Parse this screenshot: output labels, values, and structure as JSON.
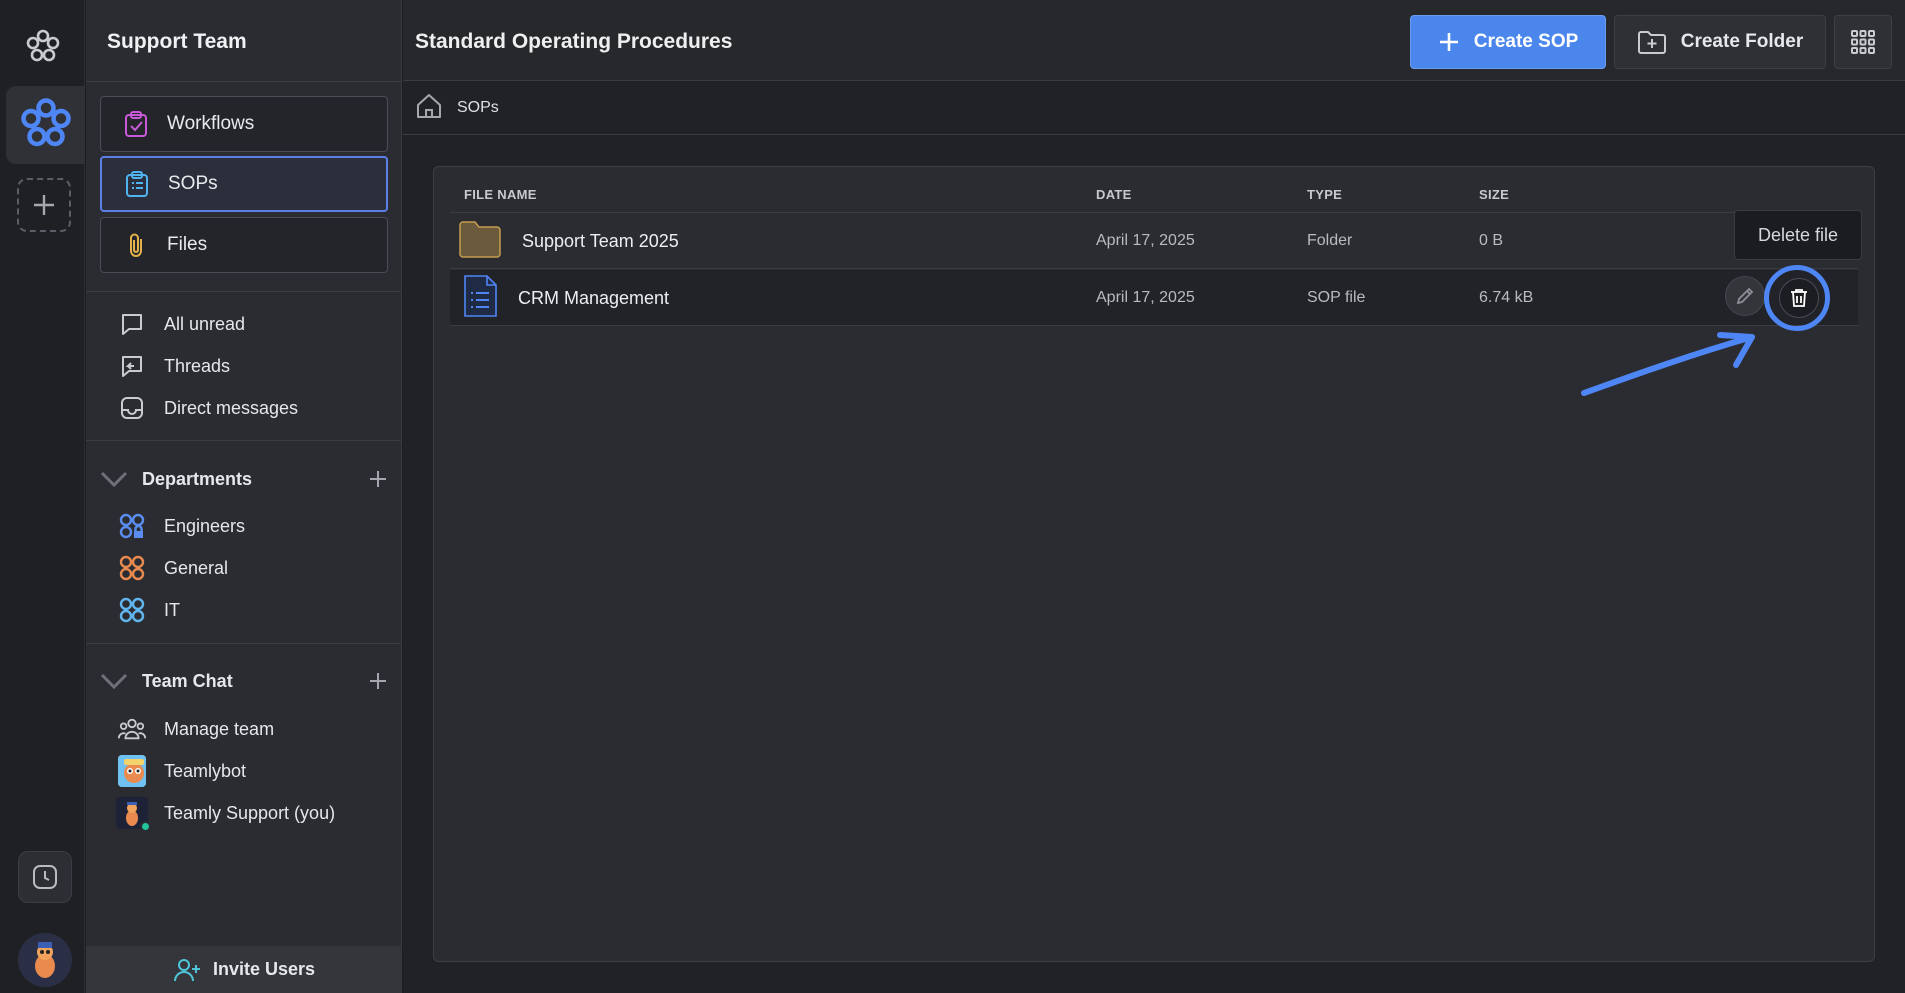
{
  "sidebar": {
    "team_name": "Support Team",
    "nav": [
      {
        "label": "Workflows",
        "icon": "clipboard-check-icon"
      },
      {
        "label": "SOPs",
        "icon": "clipboard-list-icon"
      },
      {
        "label": "Files",
        "icon": "paperclip-icon"
      }
    ],
    "inbox": [
      {
        "label": "All unread",
        "icon": "chat-bubble-icon"
      },
      {
        "label": "Threads",
        "icon": "threads-icon"
      },
      {
        "label": "Direct messages",
        "icon": "inbox-icon"
      }
    ],
    "departments": {
      "title": "Departments",
      "items": [
        {
          "label": "Engineers",
          "icon": "department-locked-icon",
          "color": "#5b8df0"
        },
        {
          "label": "General",
          "icon": "department-icon",
          "color": "#e98a4f"
        },
        {
          "label": "IT",
          "icon": "department-icon",
          "color": "#62b6f0"
        }
      ]
    },
    "team_chat": {
      "title": "Team Chat",
      "items": [
        {
          "label": "Manage team",
          "icon": "team-icon"
        },
        {
          "label": "Teamlybot",
          "icon": "bot-avatar"
        },
        {
          "label": "Teamly Support (you)",
          "icon": "user-avatar"
        }
      ]
    },
    "invite_label": "Invite Users"
  },
  "header": {
    "title": "Standard Operating Procedures",
    "create_sop_label": "Create SOP",
    "create_folder_label": "Create Folder"
  },
  "breadcrumb": {
    "current": "SOPs"
  },
  "table": {
    "columns": [
      "FILE NAME",
      "DATE",
      "TYPE",
      "SIZE"
    ],
    "rows": [
      {
        "name": "Support Team 2025",
        "date": "April 17, 2025",
        "type": "Folder",
        "size": "0 B",
        "icon": "folder-icon"
      },
      {
        "name": "CRM Management",
        "date": "April 17, 2025",
        "type": "SOP file",
        "size": "6.74 kB",
        "icon": "sop-file-icon"
      }
    ]
  },
  "tooltip": {
    "text": "Delete file"
  },
  "colors": {
    "accent": "#4a86ec",
    "highlight": "#4f86f5",
    "online": "#23c39b"
  }
}
